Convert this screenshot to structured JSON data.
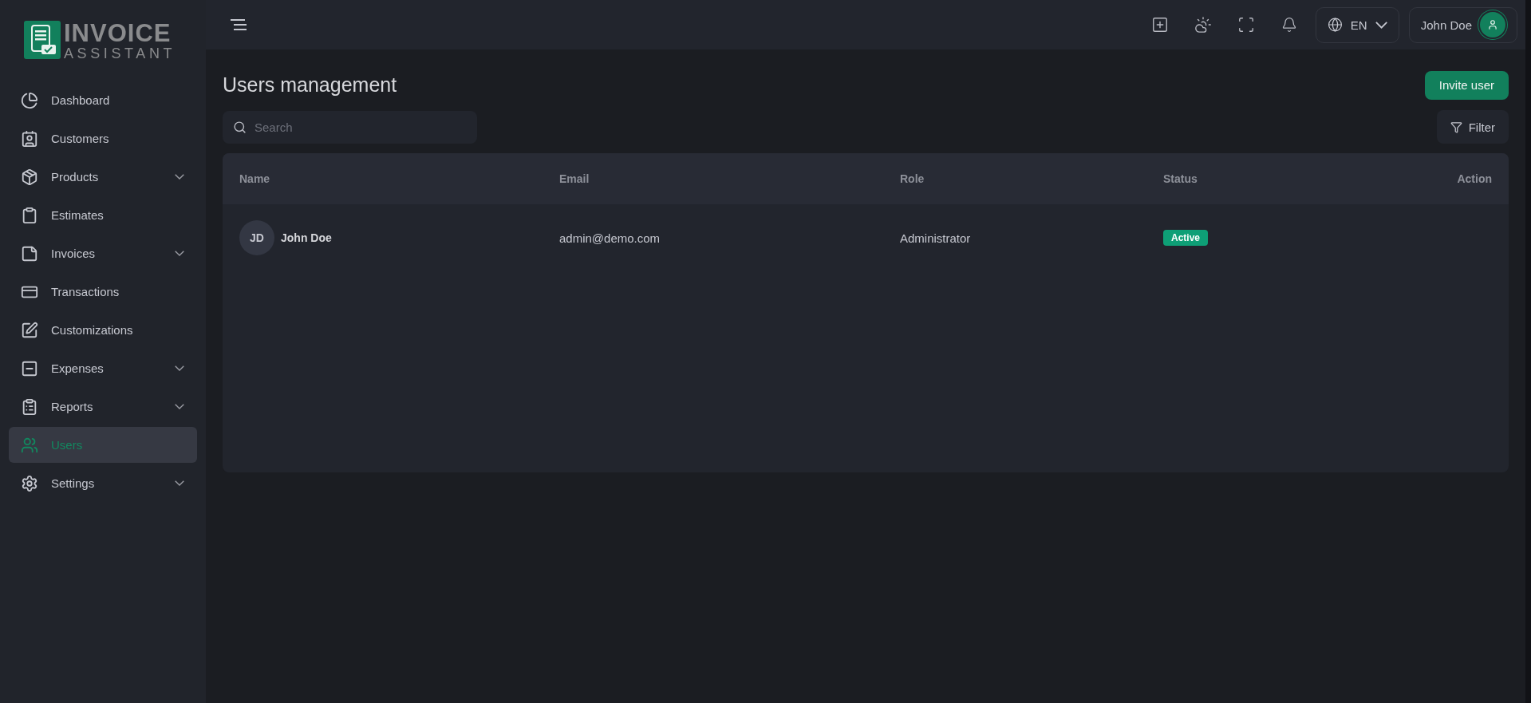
{
  "logo": {
    "line_1": "INVOICE",
    "line_2": "ASSISTANT"
  },
  "sidebar": {
    "items": [
      {
        "label": "Dashboard",
        "submenu": false,
        "selected": false
      },
      {
        "label": "Customers",
        "submenu": false,
        "selected": false
      },
      {
        "label": "Products",
        "submenu": true,
        "selected": false
      },
      {
        "label": "Estimates",
        "submenu": false,
        "selected": false
      },
      {
        "label": "Invoices",
        "submenu": true,
        "selected": false
      },
      {
        "label": "Transactions",
        "submenu": false,
        "selected": false
      },
      {
        "label": "Customizations",
        "submenu": false,
        "selected": false
      },
      {
        "label": "Expenses",
        "submenu": true,
        "selected": false
      },
      {
        "label": "Reports",
        "submenu": true,
        "selected": false
      },
      {
        "label": "Users",
        "submenu": false,
        "selected": true
      },
      {
        "label": "Settings",
        "submenu": true,
        "selected": false
      }
    ]
  },
  "topbar": {
    "language": "EN",
    "user_name": "John Doe"
  },
  "page": {
    "title": "Users management",
    "invite_button": "Invite user",
    "search": {
      "placeholder": "Search"
    },
    "filter_button": "Filter"
  },
  "table": {
    "columns": [
      "Name",
      "Email",
      "Role",
      "Status",
      "Action"
    ],
    "rows": [
      {
        "initials": "JD",
        "name": "John Doe",
        "email": "admin@demo.com",
        "role": "Administrator",
        "status": "Active",
        "active": true
      }
    ]
  }
}
